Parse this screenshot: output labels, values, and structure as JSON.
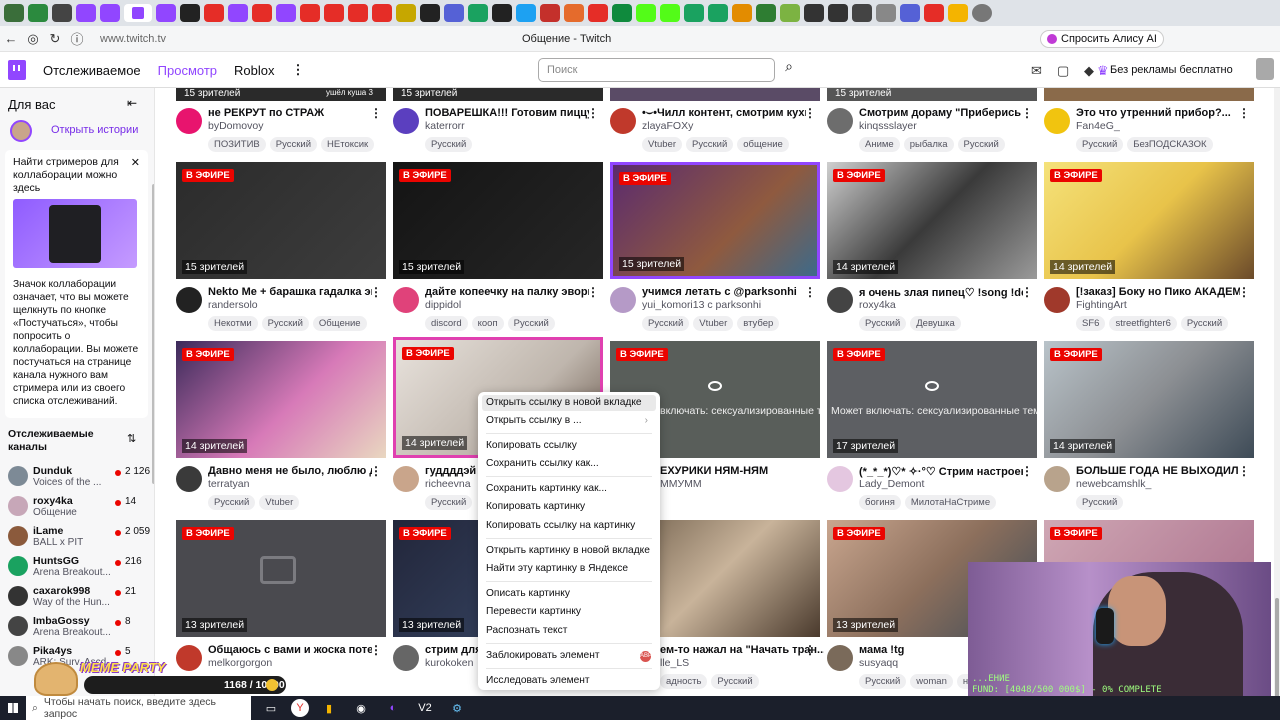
{
  "browser": {
    "url": "www.twitch.tv",
    "window_title": "Общение - Twitch",
    "alice_button": "Спросить Алису AI"
  },
  "twitch_nav": {
    "following": "Отслеживаемое",
    "browse": "Просмотр",
    "roblox": "Roblox",
    "search_placeholder": "Поиск",
    "ad_free": "Без рекламы бесплатно"
  },
  "sidebar": {
    "for_you": "Для вас",
    "open_stories": "Открыть истории",
    "collab_title": "Найти стримеров для коллаборации можно здесь",
    "collab_text": "Значок коллаборации означает, что вы можете щелкнуть по кнопке «Постучаться», чтобы попросить о коллаборации. Вы можете постучаться на странице канала нужного вам стримера или из своего списка отслеживаний.",
    "followed_title": "Отслеживаемые каналы",
    "channels": [
      {
        "name": "Dunduk",
        "sub": "Voices of the ...",
        "count": "2 126"
      },
      {
        "name": "roxy4ka",
        "sub": "Общение",
        "count": "14"
      },
      {
        "name": "iLame",
        "sub": "BALL x PIT",
        "count": "2 059"
      },
      {
        "name": "HuntsGG",
        "sub": "Arena Breakout...",
        "count": "216"
      },
      {
        "name": "caxarok998",
        "sub": "Way of the Hun...",
        "count": "21"
      },
      {
        "name": "ImbaGossy",
        "sub": "Arena Breakout...",
        "count": "8"
      },
      {
        "name": "Pika4ys",
        "sub": "ARK: Surv. Ascd",
        "count": "5"
      }
    ]
  },
  "cards_row0": [
    {
      "title": "не РЕКРУТ по СТРАЖ",
      "channel": "byDomovoy",
      "tags": [
        "ПОЗИТИВ",
        "Русский",
        "НЕтоксик"
      ]
    },
    {
      "title": "ПОВАРЕШКА!!! Готовим пиццу! It...",
      "channel": "katerrorr",
      "tags": [
        "Русский"
      ]
    },
    {
      "title": "•⌣•Чилл контент, смотрим кухн...",
      "channel": "zlayaFOXy",
      "tags": [
        "Vtuber",
        "Русский",
        "общение"
      ]
    },
    {
      "title": "Смотрим дораму \"Приберись по...",
      "channel": "kinqssslayer",
      "tags": [
        "Аниме",
        "рыбалка",
        "Русский"
      ]
    },
    {
      "title": "Это что утренний прибор?...",
      "channel": "Fan4eG_",
      "tags": [
        "Русский",
        "БезПОДСКАЗОК"
      ]
    }
  ],
  "row0_overlays": [
    "15 зрителей",
    "15 зрителей",
    "15 зрителей",
    "ушёл куша 3"
  ],
  "cards_row1": [
    {
      "live": "В ЭФИРЕ",
      "viewers": "15 зрителей",
      "title": "Nekto Me + барашка гадалка эгои...",
      "channel": "randersolo",
      "tags": [
        "Некотми",
        "Русский",
        "Общение"
      ]
    },
    {
      "live": "В ЭФИРЕ",
      "viewers": "15 зрителей",
      "title": "дайте копеечку на палку эвори ...",
      "channel": "dippidol",
      "tags": [
        "discord",
        "кооп",
        "Русский"
      ]
    },
    {
      "live": "В ЭФИРЕ",
      "viewers": "15 зрителей",
      "title": "учимся летать с @parksonhi",
      "channel": "yui_komori13 с parksonhi",
      "tags": [
        "Русский",
        "Vtuber",
        "втубер"
      ]
    },
    {
      "live": "В ЭФИРЕ",
      "viewers": "14 зрителей",
      "title": "я очень злая пипец♡ !song !donate",
      "channel": "roxy4ka",
      "tags": [
        "Русский",
        "Девушка"
      ]
    },
    {
      "live": "В ЭФИРЕ",
      "viewers": "14 зрителей",
      "title": "[!заказ] Боку но Пико АКАДЕМИ...",
      "channel": "FightingArt",
      "tags": [
        "SF6",
        "streetfighter6",
        "Русский"
      ]
    }
  ],
  "cards_row2": [
    {
      "live": "В ЭФИРЕ",
      "viewers": "14 зрителей",
      "title": "Давно меня не было, люблю день...",
      "channel": "terratyan",
      "tags": [
        "Русский",
        "Vtuber"
      ]
    },
    {
      "live": "В ЭФИРЕ",
      "viewers": "14 зрителей",
      "title": "гуддддэй",
      "channel": "richeevna",
      "tags": [
        "Русский"
      ]
    },
    {
      "live": "В ЭФИРЕ",
      "viewers": "",
      "title": "ЕХУРИКИ НЯМ-НЯМ",
      "channel": "ММУММ",
      "tags": [],
      "hidden": "включать: сексуализированные темы"
    },
    {
      "live": "В ЭФИРЕ",
      "viewers": "17 зрителей",
      "title": "(*_*_*)♡* ✧·°♡ Стрим настроек...",
      "channel": "Lady_Demont",
      "tags": [
        "богиня",
        "МилотаНаСтриме"
      ],
      "hidden": "Может включать: сексуализированные темы"
    },
    {
      "live": "В ЭФИРЕ",
      "viewers": "14 зрителей",
      "title": "БОЛЬШЕ ГОДА НЕ ВЫХОДИЛ ИЗ ...",
      "channel": "newebcamshlk_",
      "tags": [
        "Русский"
      ]
    }
  ],
  "cards_row3": [
    {
      "live": "В ЭФИРЕ",
      "viewers": "13 зрителей",
      "title": "Общаюсь с вами и жоска потею ...",
      "channel": "melkorgorgon",
      "tags": []
    },
    {
      "live": "В ЭФИРЕ",
      "viewers": "13 зрителей",
      "title": "стрим для л...",
      "channel": "kurokoken",
      "tags": []
    },
    {
      "live": "",
      "viewers": "",
      "title": "ем-то нажал на \"Начать тран...",
      "channel": "lle_LS",
      "tags": [
        "адность",
        "Русский"
      ]
    },
    {
      "live": "В ЭФИРЕ",
      "viewers": "13 зрителей",
      "title": "мама !tg",
      "channel": "susyaqq",
      "tags": [
        "Русский",
        "woman",
        "ну"
      ]
    },
    {
      "live": "В ЭФИРЕ",
      "viewers": "",
      "title": "",
      "channel": "",
      "tags": []
    }
  ],
  "context_menu": {
    "items": [
      "Открыть ссылку в новой вкладке",
      "Открыть ссылку в ...",
      "Копировать ссылку",
      "Сохранить ссылку как...",
      "Сохранить картинку как...",
      "Копировать картинку",
      "Копировать ссылку на картинку",
      "Открыть картинку в новой вкладке",
      "Найти эту картинку в Яндексе",
      "Описать картинку",
      "Перевести картинку",
      "Распознать текст",
      "Заблокировать элемент",
      "Исследовать элемент"
    ],
    "abp": "ABP"
  },
  "overlay": {
    "meme_party": "MEME PARTY",
    "meme_count": "1168 / 10000",
    "webcam_line1": "...ЕНИЕ",
    "webcam_line2": "FUND: [4048/500 000$] - 0% COMPLETE"
  },
  "taskbar": {
    "search": "Чтобы начать поиск, введите здесь запрос",
    "v2": "V2"
  },
  "colors": {
    "twitch_purple": "#9146ff",
    "live_red": "#eb0400"
  }
}
